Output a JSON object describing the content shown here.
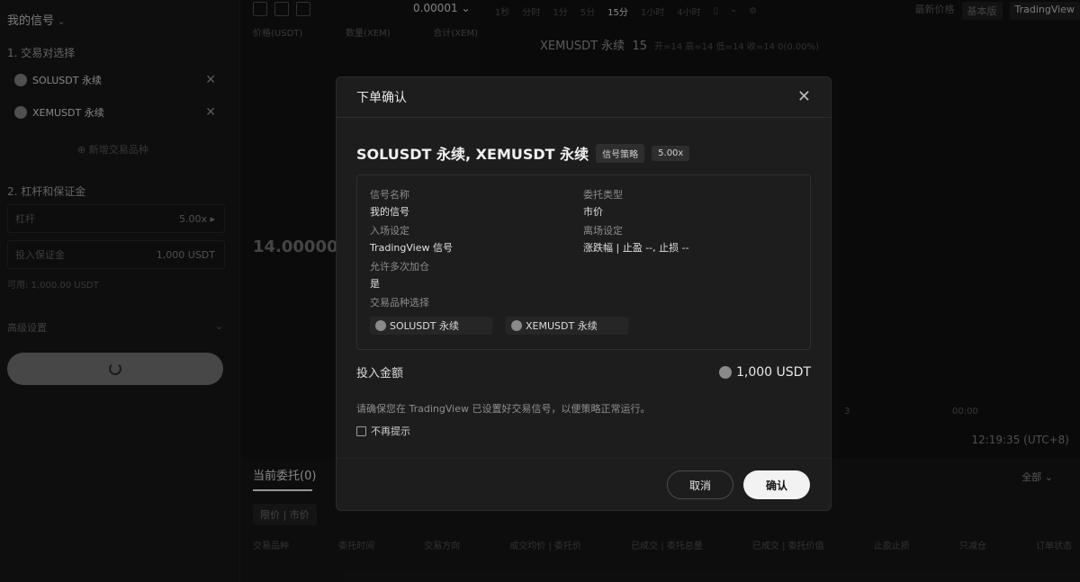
{
  "left": {
    "title": "我的信号",
    "section_pairs": "1. 交易对选择",
    "pairs": [
      "SOLUSDT 永续",
      "XEMUSDT 永续"
    ],
    "add_pair": "新增交易品种",
    "section_leverage": "2. 杠杆和保证金",
    "leverage_label": "杠杆",
    "leverage_value": "5.00x",
    "margin_label": "投入保证金",
    "margin_value": "1,000  USDT",
    "available": "可用: 1,000.00 USDT",
    "advanced": "高级设置"
  },
  "book": {
    "precision": "0.00001",
    "headers": [
      "价格(USDT)",
      "数量(XEM)",
      "合计(XEM)"
    ],
    "mid_price": "14.00000"
  },
  "chart": {
    "timeframes": [
      "1秒",
      "分时",
      "1分",
      "5分",
      "15分",
      "1小时",
      "4小时"
    ],
    "active_tf": "15分",
    "price_type": "最新价格",
    "basic": "基本版",
    "tv": "TradingView",
    "symbol": "XEMUSDT 永续",
    "interval": "15",
    "ohlc": "开=14  高=14  低=14  收=14  0(0.00%)",
    "time": "12:19:35 (UTC+8)",
    "tick_a": "3",
    "tick_b": "00:00"
  },
  "bottom": {
    "tab": "当前委托(0)",
    "filter": "限价 | 市价",
    "all": "全部",
    "columns": [
      "交易品种",
      "委托时间",
      "交易方向",
      "成交均价 | 委托价",
      "已成交 | 委托总量",
      "已成交 | 委托价值",
      "止盈止损",
      "只减仓",
      "订单状态"
    ]
  },
  "modal": {
    "title": "下单确认",
    "pairs_title": "SOLUSDT 永续, XEMUSDT 永续",
    "badge_strategy": "信号策略",
    "badge_leverage": "5.00x",
    "signal_name_label": "信号名称",
    "signal_name": "我的信号",
    "order_type_label": "委托类型",
    "order_type": "市价",
    "entry_label": "入场设定",
    "entry": "TradingView 信号",
    "exit_label": "离场设定",
    "exit": "涨跌幅 | 止盈 --, 止损 --",
    "multi_label": "允许多次加仓",
    "multi": "是",
    "symbols_label": "交易品种选择",
    "symbols": [
      "SOLUSDT 永续",
      "XEMUSDT 永续"
    ],
    "invest_label": "投入金额",
    "invest_value": "1,000 USDT",
    "notice": "请确保您在 TradingView 已设置好交易信号，以便策略正常运行。",
    "dont_show": "不再提示",
    "cancel": "取消",
    "confirm": "确认"
  }
}
